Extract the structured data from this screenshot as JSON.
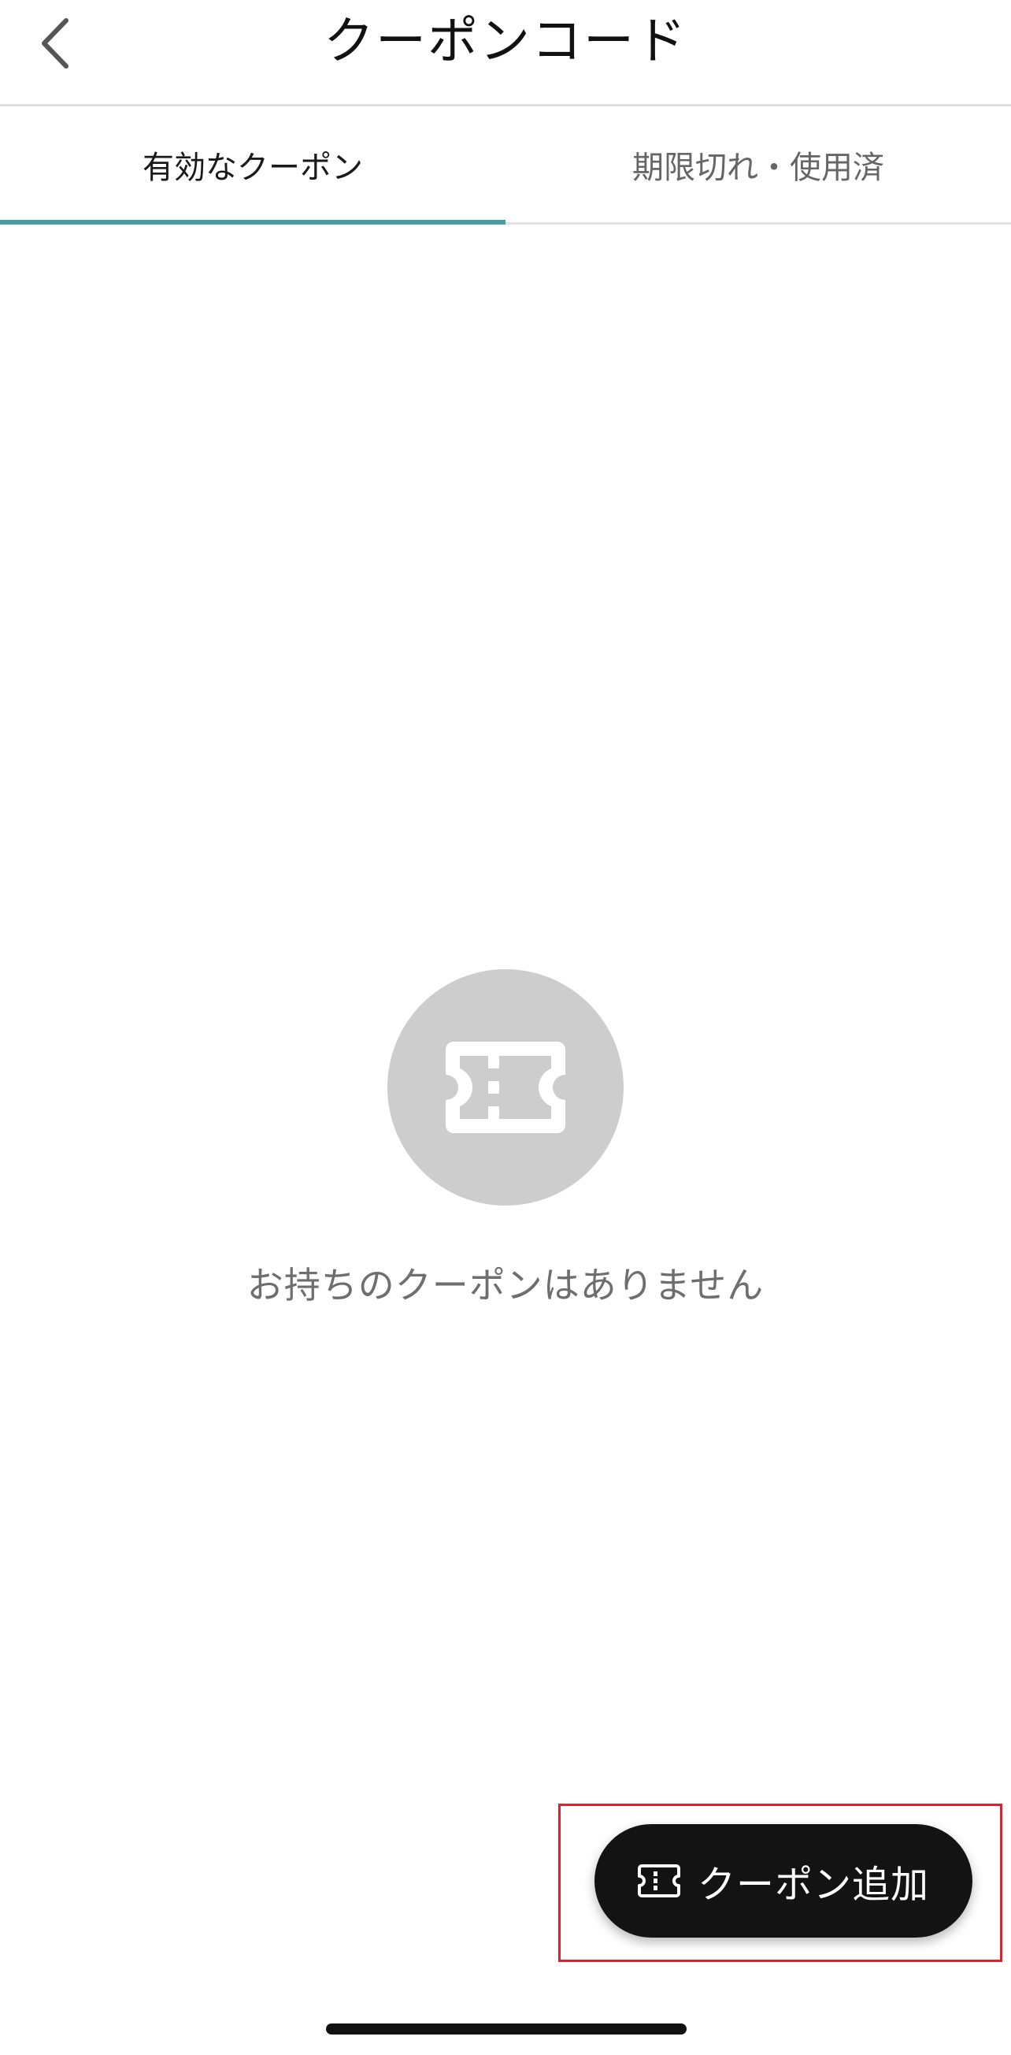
{
  "header": {
    "title": "クーポンコード",
    "back_icon": "chevron-left-icon"
  },
  "tabs": [
    {
      "label": "有効なクーポン",
      "active": true
    },
    {
      "label": "期限切れ・使用済",
      "active": false
    }
  ],
  "empty_state": {
    "icon": "ticket-icon",
    "message": "お持ちのクーポンはありません"
  },
  "fab": {
    "icon": "ticket-icon",
    "label": "クーポン追加"
  },
  "colors": {
    "accent": "#4a9ea0",
    "fab_background": "#131313",
    "empty_icon_background": "#cdcdcd",
    "highlight": "#d9232e"
  }
}
